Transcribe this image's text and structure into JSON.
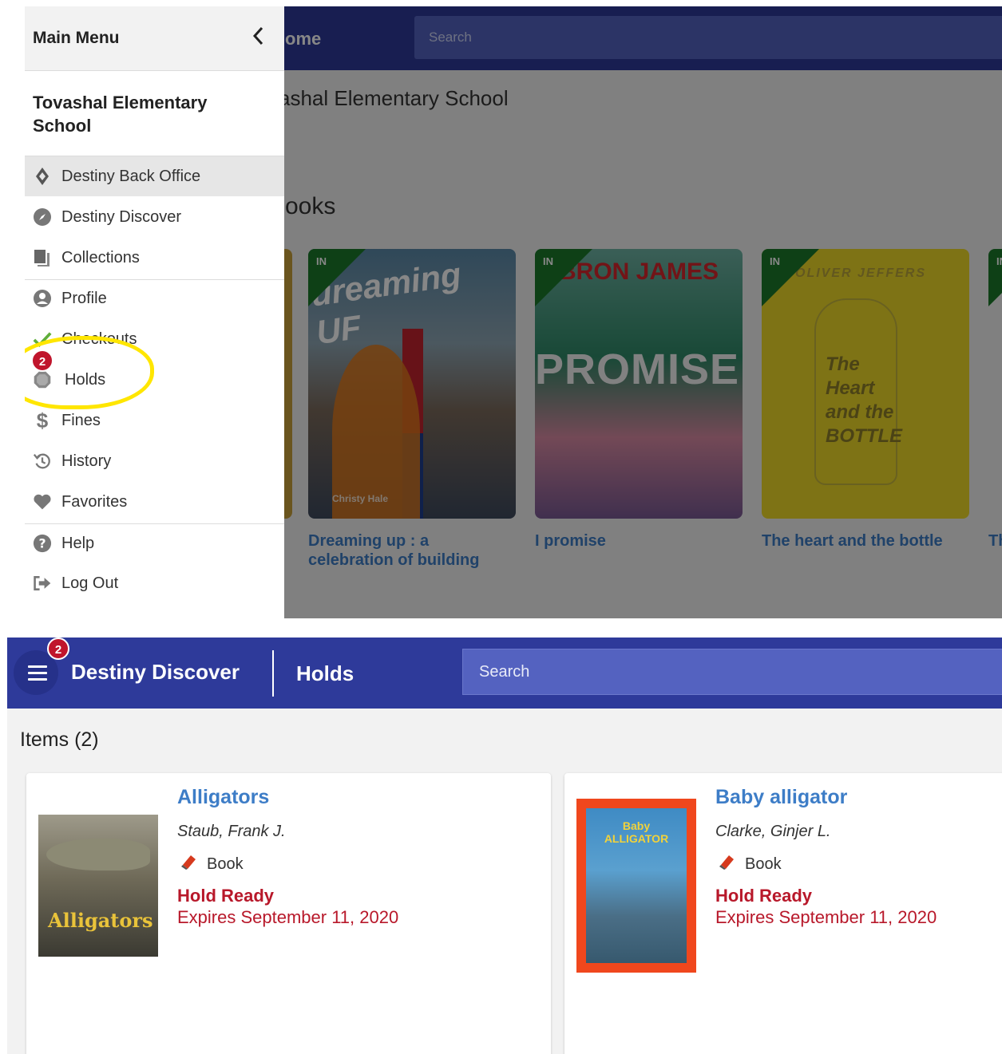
{
  "top": {
    "background": {
      "header_title": "ome",
      "search_placeholder": "Search",
      "school_name": "ashal Elementary School",
      "section_title": "ooks",
      "books": [
        {
          "status": "IN",
          "cover_text": "ureaming UF",
          "author_text": "Christy Hale",
          "title": "Dreaming up : a celebration of building"
        },
        {
          "status": "IN",
          "cover_text": "PROMISE",
          "top_text": "BRON JAMES",
          "title": "I promise"
        },
        {
          "status": "IN",
          "cover_text": "The Heart and the BOTTLE",
          "top_text": "OLIVER JEFFERS",
          "title": "The heart and the bottle"
        },
        {
          "status": "IN",
          "title": "Th"
        }
      ]
    },
    "menu": {
      "title": "Main Menu",
      "school": "Tovashal Elementary School",
      "items": [
        {
          "label": "Destiny Back Office",
          "icon": "diamond-icon"
        },
        {
          "label": "Destiny Discover",
          "icon": "compass-icon"
        },
        {
          "label": "Collections",
          "icon": "collections-icon"
        },
        {
          "label": "Profile",
          "icon": "user-icon"
        },
        {
          "label": "Checkouts",
          "icon": "check-icon"
        },
        {
          "label": "Holds",
          "icon": "hold-icon",
          "badge": "2"
        },
        {
          "label": "Fines",
          "icon": "dollar-icon"
        },
        {
          "label": "History",
          "icon": "history-icon"
        },
        {
          "label": "Favorites",
          "icon": "heart-icon"
        },
        {
          "label": "Help",
          "icon": "help-icon"
        },
        {
          "label": "Log Out",
          "icon": "logout-icon"
        }
      ]
    }
  },
  "bottom": {
    "header": {
      "badge": "2",
      "brand": "Destiny Discover",
      "page_title": "Holds",
      "search_placeholder": "Search"
    },
    "items_label": "Items",
    "items_count": "(2)",
    "holds": [
      {
        "title": "Alligators",
        "author": "Staub, Frank J.",
        "format": "Book",
        "status": "Hold Ready",
        "expires": "Expires September 11, 2020",
        "cover_text": "Alligators"
      },
      {
        "title": "Baby alligator",
        "author": "Clarke, Ginjer L.",
        "format": "Book",
        "status": "Hold Ready",
        "expires": "Expires September 11, 2020",
        "cover_text": "Baby ALLIGATOR"
      }
    ]
  },
  "colors": {
    "header_blue": "#2e3a9a",
    "search_blue": "#5462c0",
    "link_blue": "#3d7dc7",
    "status_red": "#b8182a",
    "badge_red": "#c0152c",
    "highlight_yellow": "#ffe600"
  }
}
